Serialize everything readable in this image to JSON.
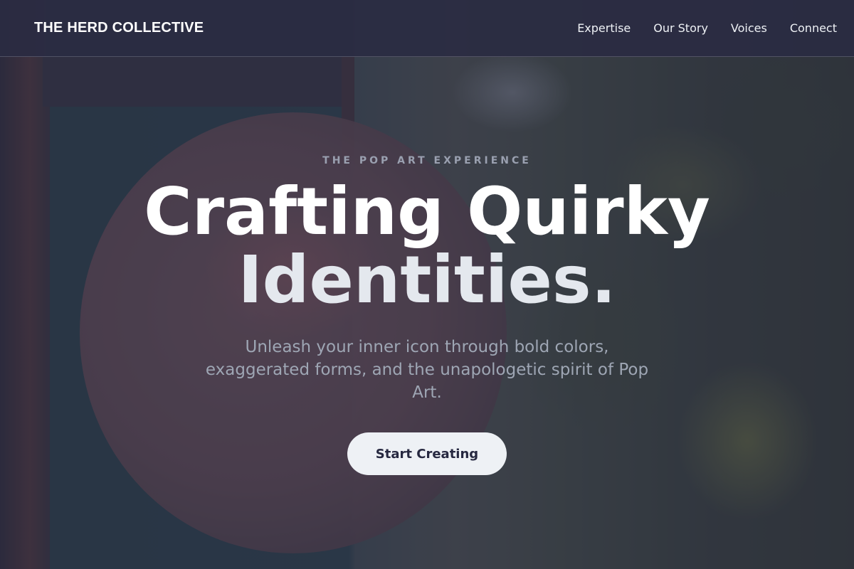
{
  "header": {
    "brand": "THE HERD COLLECTIVE",
    "nav": [
      {
        "label": "Expertise"
      },
      {
        "label": "Our Story"
      },
      {
        "label": "Voices"
      },
      {
        "label": "Connect"
      }
    ]
  },
  "hero": {
    "eyebrow": "THE POP ART EXPERIENCE",
    "headline_line1": "Crafting Quirky",
    "headline_line2": "Identities.",
    "subtitle": "Unleash your inner icon through bold colors, exaggerated forms, and the unapologetic spirit of Pop Art.",
    "cta_label": "Start Creating"
  },
  "colors": {
    "header_bg": "#2a2b42",
    "text_primary": "#ffffff",
    "text_muted": "#9ea6b4",
    "button_bg": "#eef1f5",
    "button_text": "#262840"
  }
}
